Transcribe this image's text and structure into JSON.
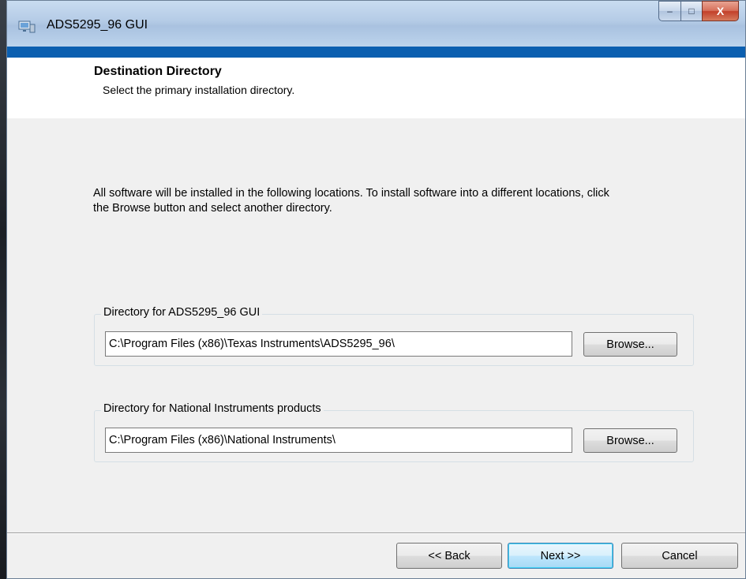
{
  "window": {
    "title": "ADS5295_96 GUI",
    "controls": {
      "minimize": "–",
      "maximize": "□",
      "close": "X"
    }
  },
  "header": {
    "title": "Destination Directory",
    "subtitle": "Select the primary installation directory."
  },
  "content": {
    "info": "All software will be installed in the following locations. To install software into a different locations, click the Browse button and select another directory.",
    "groups": [
      {
        "label": "Directory for ADS5295_96 GUI",
        "path": "C:\\Program Files (x86)\\Texas Instruments\\ADS5295_96\\",
        "browse": "Browse..."
      },
      {
        "label": "Directory for National Instruments products",
        "path": "C:\\Program Files (x86)\\National Instruments\\",
        "browse": "Browse..."
      }
    ]
  },
  "footer": {
    "back": "<< Back",
    "next": "Next >>",
    "cancel": "Cancel"
  },
  "icons": {
    "title": "installer-app-icon"
  },
  "colors": {
    "accent_strip": "#0b5fb0",
    "close_button": "#c2402a",
    "focus_button": "#3c7fb1"
  }
}
